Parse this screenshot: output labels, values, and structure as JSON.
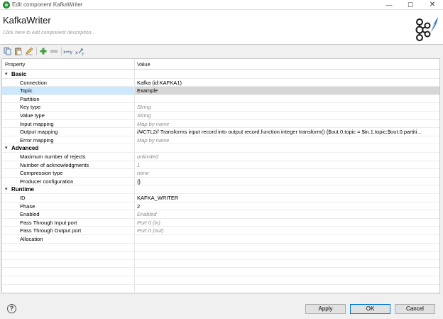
{
  "window": {
    "title": "Edit component KafkaWriter",
    "min_glyph": "—",
    "max_glyph": "☐",
    "close_glyph": "✕",
    "icon": "app-logo-icon"
  },
  "header": {
    "component_name": "KafkaWriter",
    "description_placeholder": "Click here to edit component description..."
  },
  "toolbar": {
    "items": [
      "copy-icon",
      "paste-icon",
      "edit-icon",
      "add-icon",
      "remove-icon",
      "xy-swap-icon",
      "xy-sort-icon"
    ],
    "xy_label": "x↔y"
  },
  "table": {
    "col_property": "Property",
    "col_value": "Value",
    "groups": [
      {
        "label": "Basic"
      },
      {
        "label": "Advanced"
      },
      {
        "label": "Runtime"
      }
    ],
    "rows": [
      {
        "prop": "Connection",
        "value": "Kafka (id:KAFKA1)"
      },
      {
        "prop": "Topic",
        "value": "Example"
      },
      {
        "prop": "Partition",
        "value": ""
      },
      {
        "prop": "Key type",
        "value": "String"
      },
      {
        "prop": "Value type",
        "value": "String"
      },
      {
        "prop": "Input mapping",
        "value": "Map by name"
      },
      {
        "prop": "Output mapping",
        "value": "//#CTL2// Transforms input record into output record.function integer transform() {$out.0.topic = $in.1.topic;$out.0.partiti..."
      },
      {
        "prop": "Error mapping",
        "value": "Map by name"
      },
      {
        "prop": "Maximum number of rejects",
        "value": "unlimited"
      },
      {
        "prop": "Number of acknowledgments",
        "value": "1"
      },
      {
        "prop": "Compression type",
        "value": "none"
      },
      {
        "prop": "Producer configuration",
        "value": "{}"
      },
      {
        "prop": "ID",
        "value": "KAFKA_WRITER"
      },
      {
        "prop": "Phase",
        "value": "2"
      },
      {
        "prop": "Enabled",
        "value": "Enabled"
      },
      {
        "prop": "Pass Through Input port",
        "value": "Port 0 (in)"
      },
      {
        "prop": "Pass Through Output port",
        "value": "Port 0 (out)"
      },
      {
        "prop": "Allocation",
        "value": ""
      }
    ]
  },
  "buttons": {
    "help": "?",
    "apply": "Apply",
    "ok": "OK",
    "cancel": "Cancel"
  },
  "colors": {
    "selection": "#cce8ff",
    "selected_value_bg": "#d6d6d6",
    "hint_text": "#8a8a8a",
    "logo_fill": "#1a1a1a"
  }
}
